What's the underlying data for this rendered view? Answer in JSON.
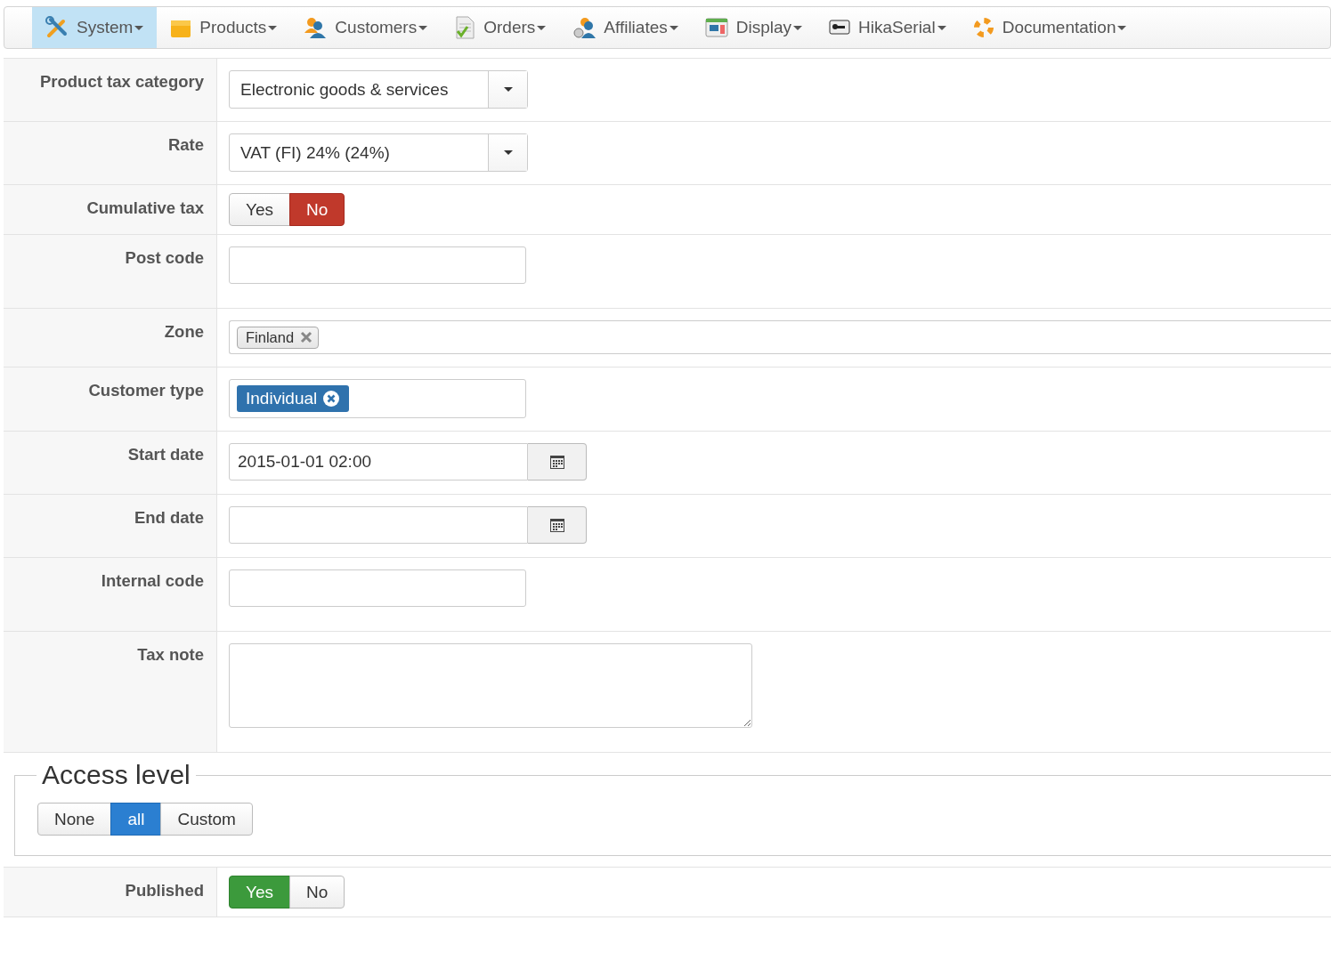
{
  "menu": [
    {
      "label": "System",
      "selected": true
    },
    {
      "label": "Products",
      "selected": false
    },
    {
      "label": "Customers",
      "selected": false
    },
    {
      "label": "Orders",
      "selected": false
    },
    {
      "label": "Affiliates",
      "selected": false
    },
    {
      "label": "Display",
      "selected": false
    },
    {
      "label": "HikaSerial",
      "selected": false
    },
    {
      "label": "Documentation",
      "selected": false
    }
  ],
  "form": [
    {
      "kind": "select",
      "label": "Product tax category",
      "value": "Electronic goods & services"
    },
    {
      "kind": "select",
      "label": "Rate",
      "value": "VAT (FI) 24% (24%)"
    },
    {
      "kind": "toggle",
      "label": "Cumulative tax",
      "options": [
        {
          "label": "Yes",
          "selected": false
        },
        {
          "label": "No",
          "selected": true
        }
      ]
    },
    {
      "kind": "text",
      "label": "Post code"
    },
    {
      "kind": "tags",
      "label": "Zone",
      "tags": [
        "Finland"
      ]
    },
    {
      "kind": "badges",
      "label": "Customer type",
      "tags": [
        "Individual"
      ]
    },
    {
      "kind": "date",
      "label": "Start date",
      "value": "2015-01-01 02:00"
    },
    {
      "kind": "date",
      "label": "End date"
    },
    {
      "kind": "text",
      "label": "Internal code"
    },
    {
      "kind": "textarea",
      "label": "Tax note"
    }
  ],
  "access_level": {
    "legend": "Access level",
    "options": [
      {
        "label": "None",
        "selected": false
      },
      {
        "label": "all",
        "selected": true
      },
      {
        "label": "Custom",
        "selected": false
      }
    ]
  },
  "published": {
    "kind": "toggle",
    "label": "Published",
    "options": [
      {
        "label": "Yes",
        "selected": true
      },
      {
        "label": "No",
        "selected": false
      }
    ]
  }
}
